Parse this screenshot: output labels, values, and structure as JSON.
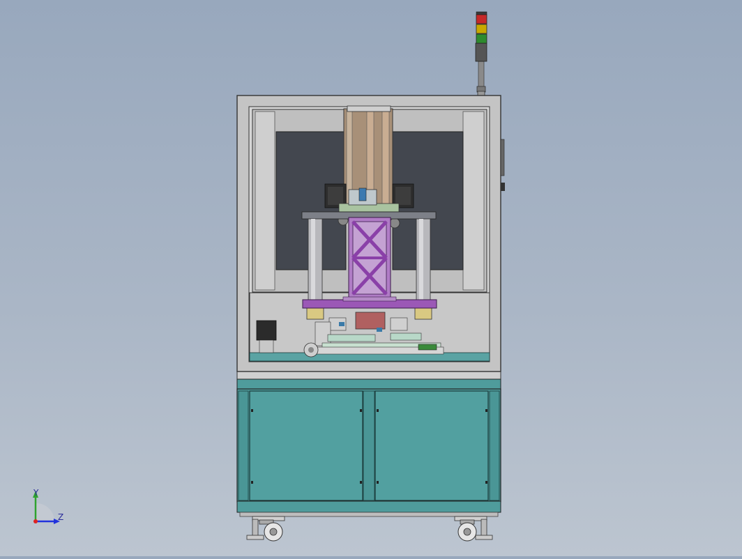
{
  "window": {
    "title": ""
  },
  "triad": {
    "y_label": "Y",
    "z_label": "Z"
  },
  "colors": {
    "background_top": "#98a8bd",
    "background_bottom": "#bcc5d0",
    "frame_gray": "#c4c4c4",
    "cabinet_teal": "#4f9c9c",
    "window_dark": "#43474f",
    "gantry_purple": "#9b58b6",
    "pillar_gray": "#b8b8bc",
    "light_red": "#c62828",
    "light_yellow": "#c9a800",
    "light_green": "#2e8b2e"
  },
  "components": [
    "signal-tower",
    "machine-frame",
    "left-window-panel",
    "right-window-panel",
    "center-column",
    "stepper-motor-left",
    "stepper-motor-right",
    "purple-lattice-gantry",
    "pillar-left",
    "pillar-right",
    "purple-platform",
    "mechanism-assembly",
    "lower-cabinet",
    "cabinet-door-left",
    "cabinet-door-right",
    "caster-left",
    "caster-right",
    "coordinate-triad"
  ]
}
